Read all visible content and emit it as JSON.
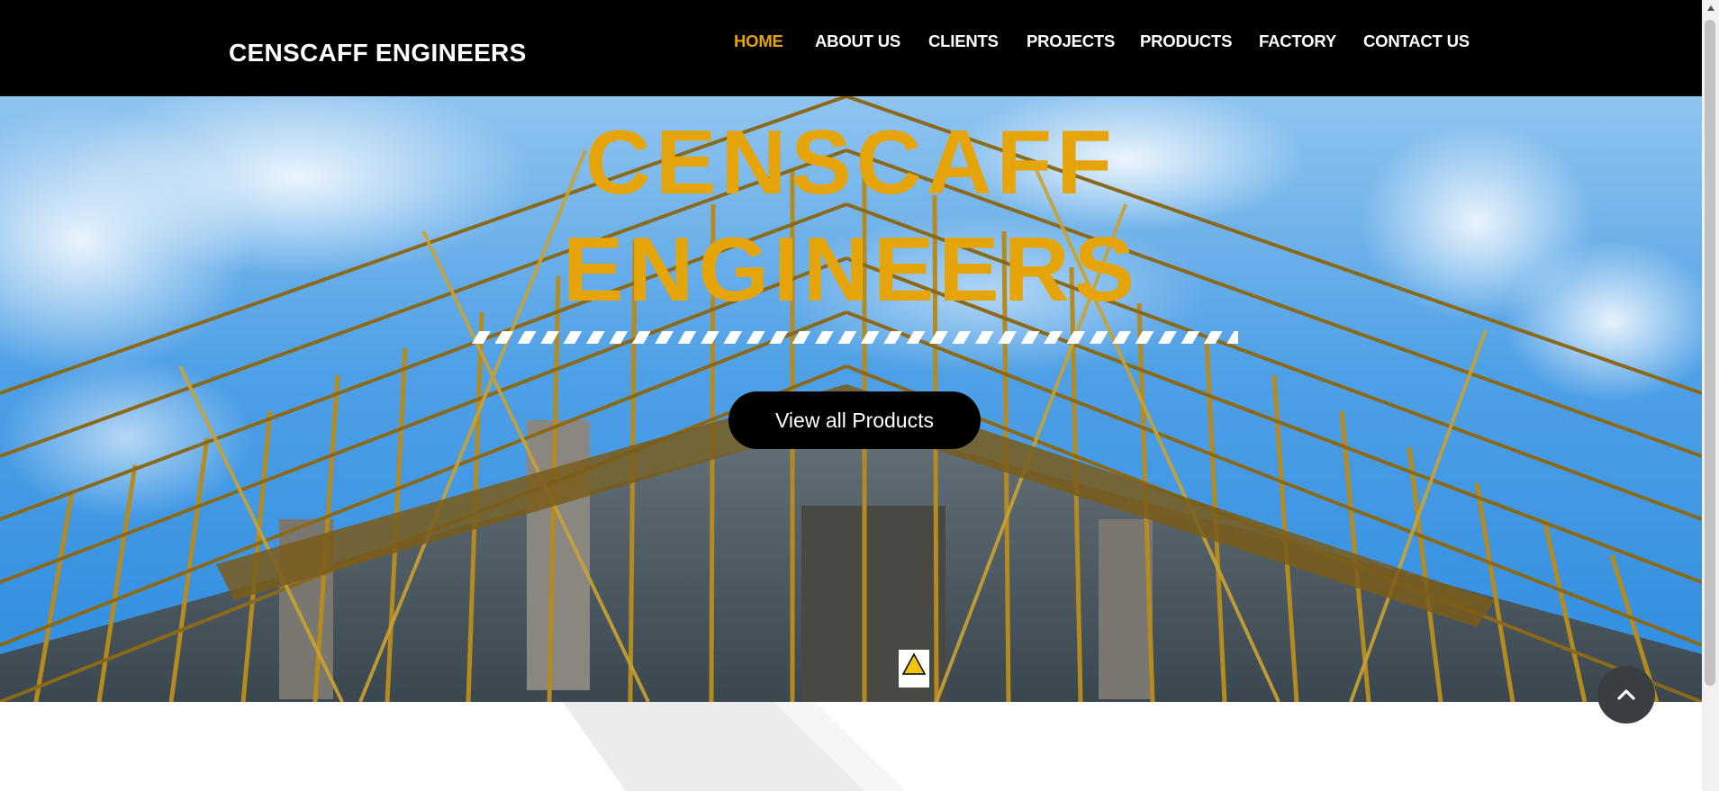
{
  "header": {
    "brand": "CENSCAFF ENGINEERS",
    "nav": [
      {
        "label": "HOME",
        "active": true
      },
      {
        "label": "ABOUT US",
        "active": false
      },
      {
        "label": "CLIENTS",
        "active": false
      },
      {
        "label": "PROJECTS",
        "active": false
      },
      {
        "label": "PRODUCTS",
        "active": false
      },
      {
        "label": "FACTORY",
        "active": false
      },
      {
        "label": "CONTACT US",
        "active": false
      }
    ]
  },
  "hero": {
    "title_line1": "CENSCAFF",
    "title_line2": "ENGINEERS",
    "cta_label": "View all Products",
    "background_image": "scaffolding-against-blue-sky"
  },
  "icons": {
    "back_to_top": "chevron-up-icon",
    "scroll_up": "scroll-up-arrow-icon"
  },
  "colors": {
    "accent": "#e5a50a",
    "header_bg": "#000000",
    "button_bg": "#000000",
    "back_to_top_bg": "#3a3d42"
  }
}
